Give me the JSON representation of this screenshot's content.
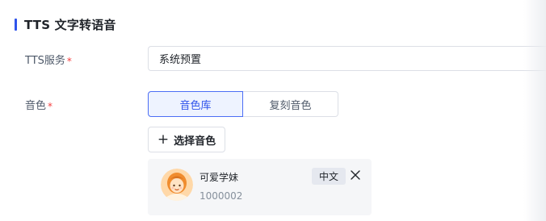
{
  "section": {
    "title": "TTS 文字转语音"
  },
  "tts_service": {
    "label": "TTS服务",
    "required_mark": "*",
    "value": "系统预置"
  },
  "voice": {
    "label": "音色",
    "required_mark": "*",
    "tabs": [
      {
        "label": "音色库",
        "active": true
      },
      {
        "label": "复刻音色",
        "active": false
      }
    ],
    "add_button_label": "选择音色",
    "add_button_icon": "plus-icon",
    "selected": {
      "name": "可爱学妹",
      "id": "1000002",
      "language": "中文",
      "remove_icon": "close-icon"
    }
  },
  "colors": {
    "accent": "#2f54eb",
    "required": "#f53f3f",
    "active_tab_bg": "#eef3ff",
    "card_bg": "#f5f6f8"
  }
}
